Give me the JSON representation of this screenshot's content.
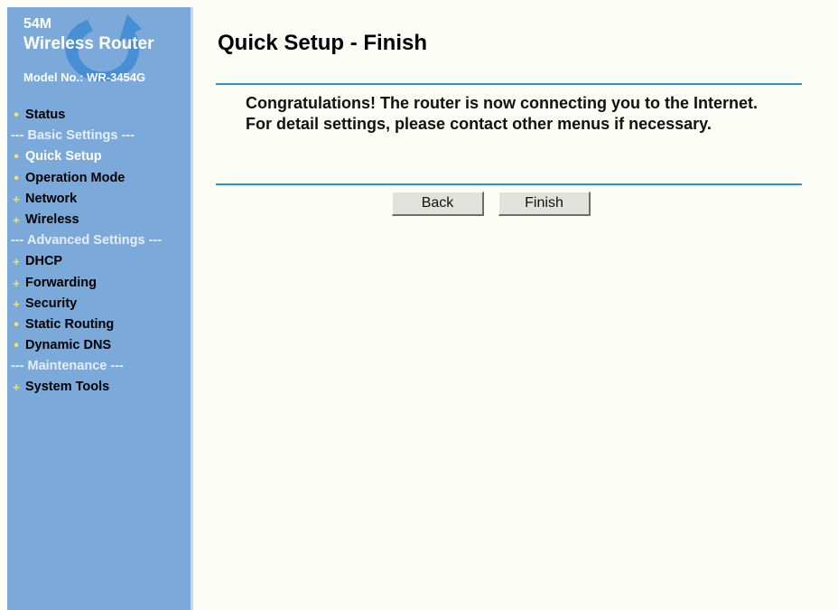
{
  "logo": {
    "line1": "54M",
    "line2": "Wireless Router",
    "line3": "Model No.: WR-3454G",
    "icon": "router-logo-swirl"
  },
  "menu": [
    {
      "type": "item",
      "label": "Status",
      "bullet": "dot"
    },
    {
      "type": "header",
      "label": "--- Basic Settings ---"
    },
    {
      "type": "item",
      "label": "Quick Setup",
      "bullet": "dot",
      "active": true
    },
    {
      "type": "item",
      "label": "Operation Mode",
      "bullet": "dot"
    },
    {
      "type": "item",
      "label": "Network",
      "bullet": "plus"
    },
    {
      "type": "item",
      "label": "Wireless",
      "bullet": "plus"
    },
    {
      "type": "header",
      "label": "--- Advanced Settings ---"
    },
    {
      "type": "item",
      "label": "DHCP",
      "bullet": "plus"
    },
    {
      "type": "item",
      "label": "Forwarding",
      "bullet": "plus"
    },
    {
      "type": "item",
      "label": "Security",
      "bullet": "plus"
    },
    {
      "type": "item",
      "label": "Static Routing",
      "bullet": "dot"
    },
    {
      "type": "item",
      "label": "Dynamic DNS",
      "bullet": "dot"
    },
    {
      "type": "header",
      "label": "--- Maintenance ---"
    },
    {
      "type": "item",
      "label": "System Tools",
      "bullet": "plus"
    }
  ],
  "main": {
    "title": "Quick Setup - Finish",
    "message": "Congratulations! The router is now connecting you to the Internet. For detail settings, please contact other menus if necessary.",
    "back_label": "Back",
    "finish_label": "Finish"
  },
  "colors": {
    "sidebar_bg": "#7ba9d9",
    "divider": "#2f8fcf",
    "page_bg": "#fdfdf7",
    "bullet": "#f5e26b"
  }
}
